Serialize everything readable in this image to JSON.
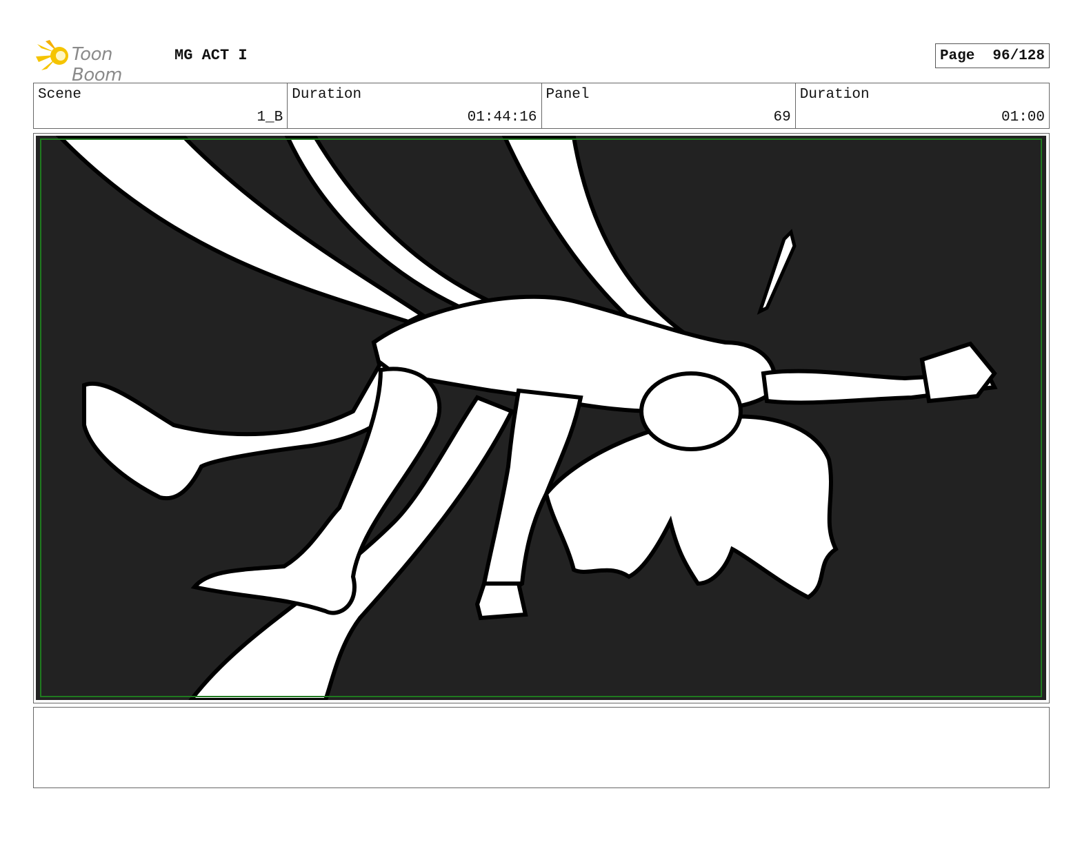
{
  "header": {
    "logo_text": "Toon Boom",
    "project_title": "MG ACT I",
    "page_label": "Page",
    "page_number": "96/128"
  },
  "info": {
    "scene_label": "Scene",
    "scene_value": "1_B",
    "duration_label": "Duration",
    "duration_value": "01:44:16",
    "panel_label": "Panel",
    "panel_value": "69",
    "panel_duration_label": "Duration",
    "panel_duration_value": "01:00"
  },
  "colors": {
    "background_dark": "#222222",
    "safe_frame": "#1f7a1f",
    "logo_accent": "#f5c400"
  },
  "icons": {
    "logo": "toon-boom-starburst-icon"
  },
  "notes": {
    "text": ""
  }
}
